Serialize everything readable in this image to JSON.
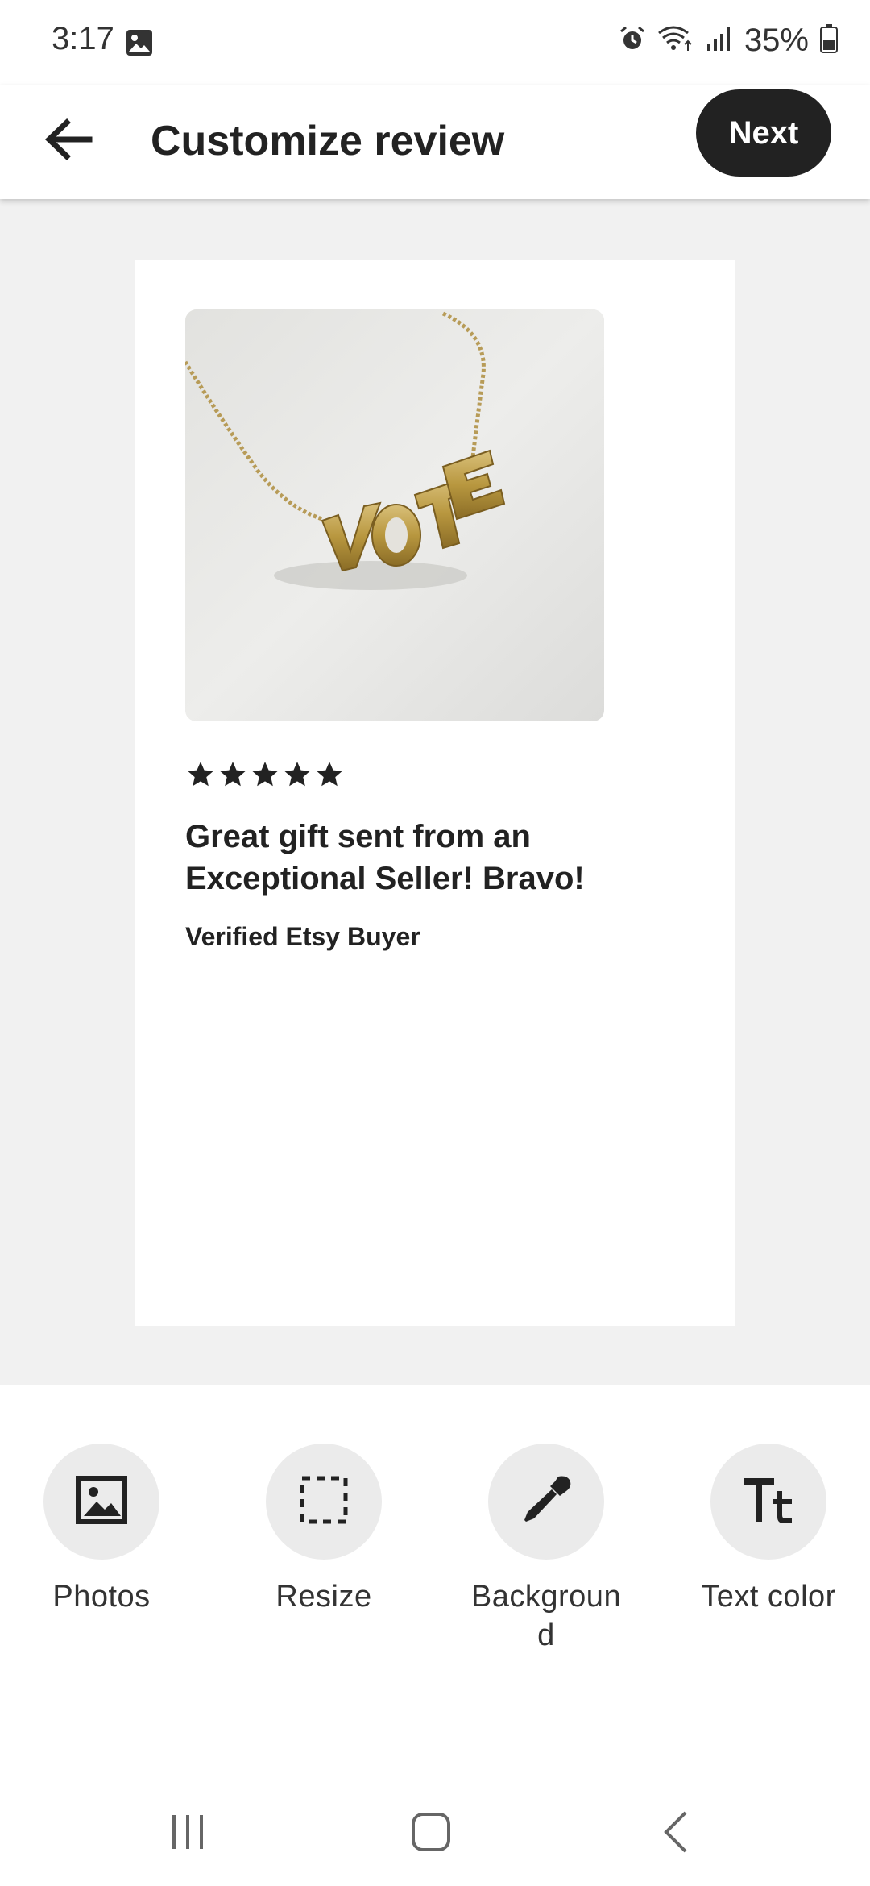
{
  "status_bar": {
    "time": "3:17",
    "battery": "35%",
    "icons": [
      "gallery-icon",
      "alarm-icon",
      "wifi-icon",
      "signal-icon",
      "battery-icon"
    ]
  },
  "app_bar": {
    "title": "Customize review",
    "next_label": "Next",
    "back_icon": "arrow-left-icon"
  },
  "review_card": {
    "photo_alt": "VOTE",
    "rating": 5,
    "text": "Great gift sent from an Exceptional Seller!  Bravo!",
    "reviewer": "Verified Etsy Buyer"
  },
  "tools": [
    {
      "label": "Photos",
      "icon": "photo-icon"
    },
    {
      "label": "Resize",
      "icon": "resize-icon"
    },
    {
      "label": "Backgroun d",
      "icon": "eyedropper-icon"
    },
    {
      "label": "Text color",
      "icon": "text-color-icon"
    }
  ],
  "colors": {
    "accent": "#222222",
    "canvas_bg": "#f1f1f1",
    "tool_bg": "#ebebeb"
  }
}
